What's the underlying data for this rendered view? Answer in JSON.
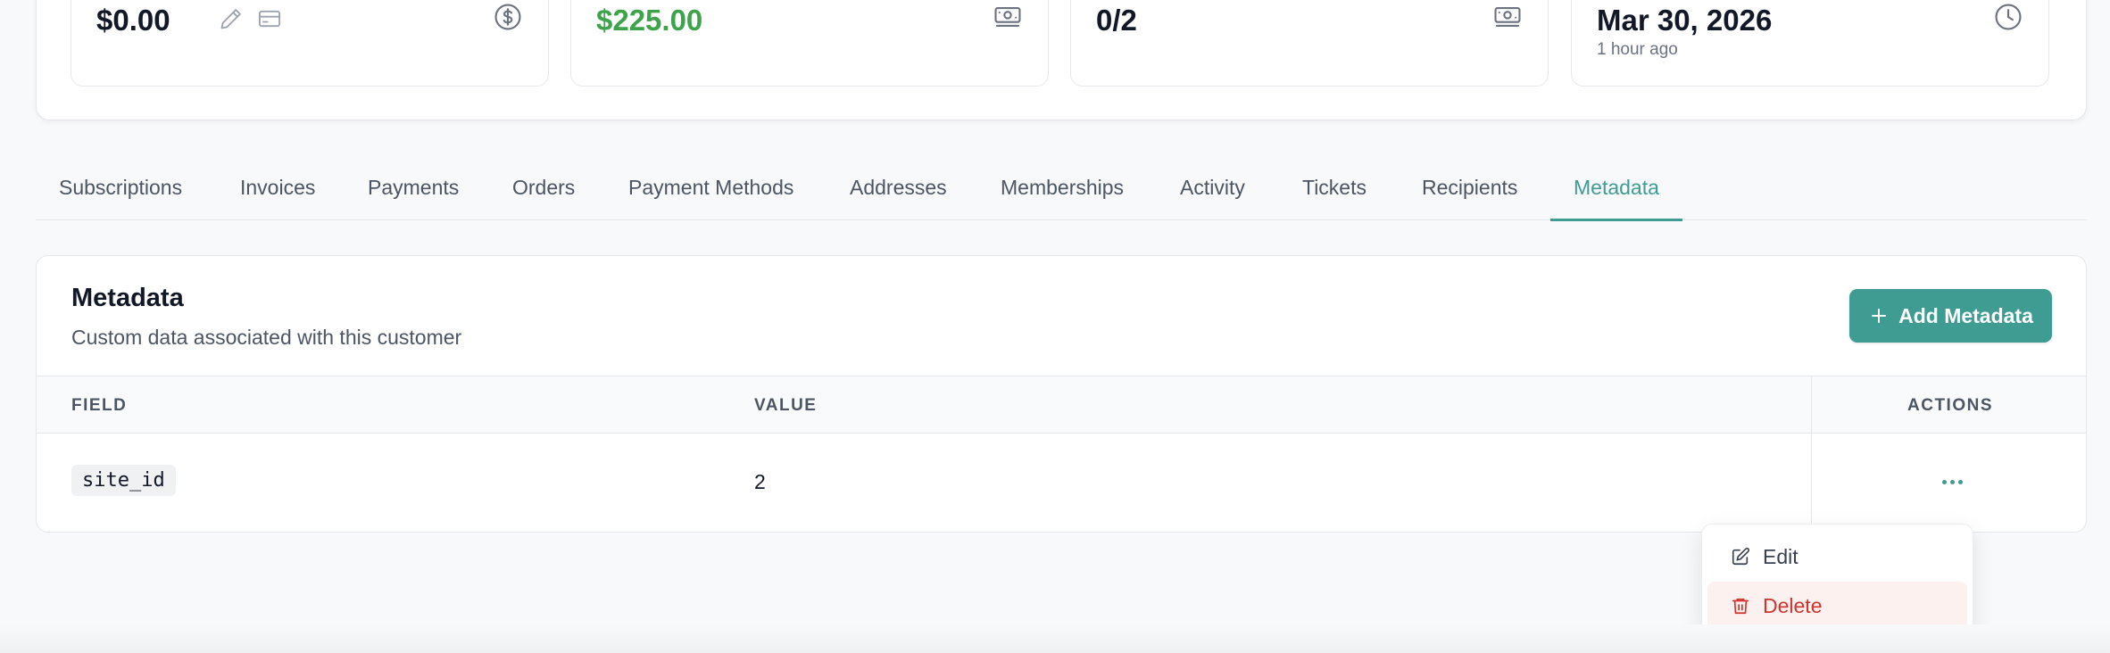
{
  "stats": [
    {
      "value": "$0.00",
      "icon": "dollar-circle-icon",
      "value_color": "#111827"
    },
    {
      "value": "$225.00",
      "icon": "banknote-icon",
      "value_color": "#3ea34b"
    },
    {
      "value": "0/2",
      "icon": "banknote-icon"
    },
    {
      "value": "Mar 30, 2026",
      "subtext": "1 hour ago",
      "icon": "clock-icon"
    }
  ],
  "stat_actions": {
    "edit_icon": "pencil-icon",
    "card_icon": "credit-card-icon"
  },
  "tabs": [
    {
      "label": "Subscriptions"
    },
    {
      "label": "Invoices"
    },
    {
      "label": "Payments"
    },
    {
      "label": "Orders"
    },
    {
      "label": "Payment Methods"
    },
    {
      "label": "Addresses"
    },
    {
      "label": "Memberships"
    },
    {
      "label": "Activity"
    },
    {
      "label": "Tickets"
    },
    {
      "label": "Recipients"
    },
    {
      "label": "Metadata",
      "active": true
    }
  ],
  "metadata": {
    "title": "Metadata",
    "subtitle": "Custom data associated with this customer",
    "add_button": "Add Metadata",
    "columns": {
      "field": "FIELD",
      "value": "VALUE",
      "actions": "ACTIONS"
    },
    "rows": [
      {
        "field": "site_id",
        "value": "2"
      }
    ]
  },
  "dropdown": {
    "items": [
      {
        "label": "Edit",
        "icon": "edit-icon"
      },
      {
        "label": "Delete",
        "icon": "trash-icon"
      }
    ]
  },
  "colors": {
    "accent": "#3e9c92",
    "success": "#3ea34b",
    "danger": "#d0342c"
  }
}
